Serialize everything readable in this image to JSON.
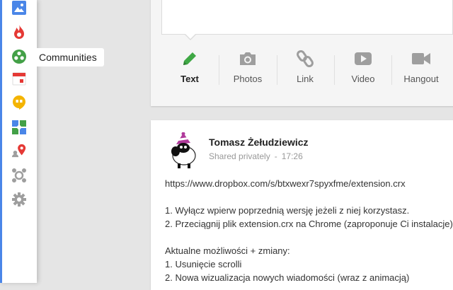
{
  "sidebar": {
    "items": [
      {
        "icon": "photos-icon"
      },
      {
        "icon": "hot-flame-icon"
      },
      {
        "icon": "communities-icon"
      },
      {
        "icon": "events-calendar-icon"
      },
      {
        "icon": "hangouts-icon"
      },
      {
        "icon": "games-icon"
      },
      {
        "icon": "local-pin-icon"
      },
      {
        "icon": "people-icon"
      },
      {
        "icon": "settings-gear-icon"
      }
    ],
    "tooltip": "Communities",
    "accent": "#4a86e8"
  },
  "compose": {
    "actions": [
      {
        "label": "Text",
        "icon": "pencil-icon",
        "color": "#3fa845",
        "active": true
      },
      {
        "label": "Photos",
        "icon": "camera-icon",
        "color": "#9e9e9e"
      },
      {
        "label": "Link",
        "icon": "link-icon",
        "color": "#9e9e9e"
      },
      {
        "label": "Video",
        "icon": "video-icon",
        "color": "#9e9e9e"
      },
      {
        "label": "Hangout",
        "icon": "hangout-camera-icon",
        "color": "#9e9e9e"
      }
    ]
  },
  "post": {
    "author": "Tomasz Żełudziewicz",
    "visibility": "Shared privately",
    "separator": "-",
    "time": "17:26",
    "lines": [
      "https://www.dropbox.com/s/btxwexr7spyxfme/extension.crx",
      "",
      "1. Wyłącz wpierw poprzednią wersję jeżeli z niej korzystasz.",
      "2. Przeciągnij plik extension.crx na Chrome (zaproponuje Ci instalacje)",
      "",
      "Aktualne możliwości + zmiany:",
      "1. Usunięcie scrolli",
      "2. Nowa wizualizacja nowych wiadomości (wraz z animacją)"
    ]
  }
}
